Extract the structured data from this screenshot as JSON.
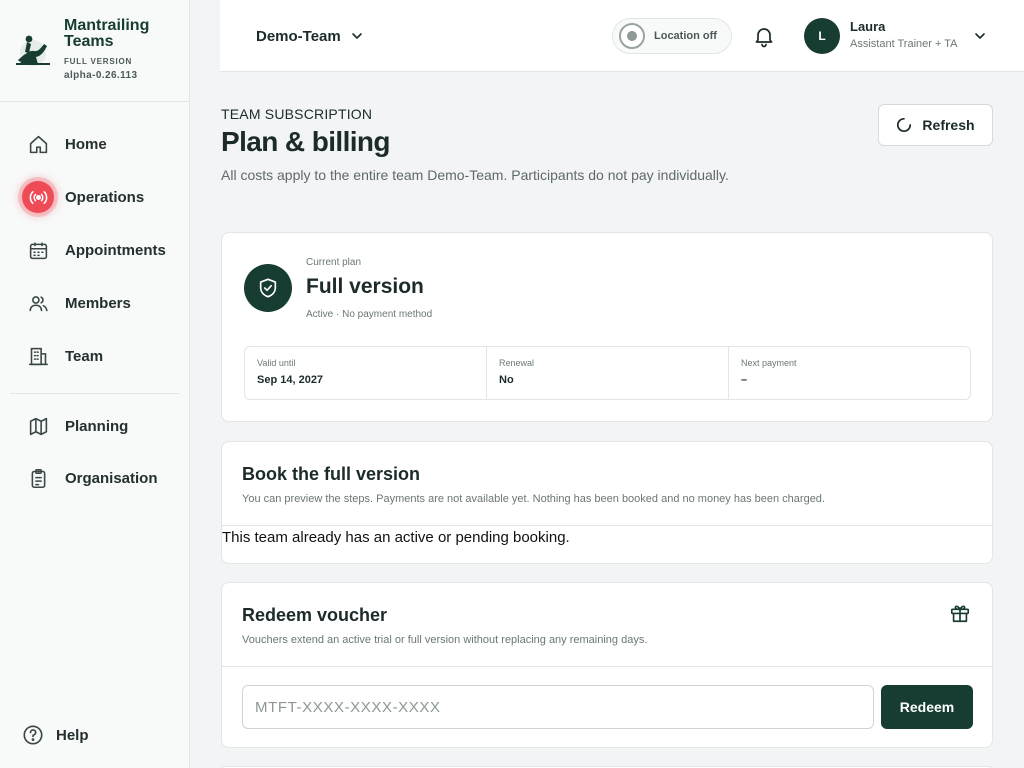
{
  "brand": {
    "name": "Mantrailing Teams",
    "edition": "FULL VERSION",
    "version": "alpha-0.26.113"
  },
  "sidebar": {
    "items": [
      {
        "label": "Home",
        "icon": "home-icon"
      },
      {
        "label": "Operations",
        "icon": "broadcast-icon",
        "live": true
      },
      {
        "label": "Appointments",
        "icon": "calendar-icon"
      },
      {
        "label": "Members",
        "icon": "users-icon"
      },
      {
        "label": "Team",
        "icon": "building-icon"
      },
      {
        "label": "Planning",
        "icon": "map-icon"
      },
      {
        "label": "Organisation",
        "icon": "clipboard-icon"
      }
    ],
    "help_label": "Help"
  },
  "header": {
    "team_name": "Demo-Team",
    "location_label": "Location off",
    "user": {
      "initial": "L",
      "name": "Laura",
      "role": "Assistant Trainer + TA"
    }
  },
  "page": {
    "eyebrow": "TEAM SUBSCRIPTION",
    "title": "Plan & billing",
    "subtitle": "All costs apply to the entire team Demo-Team. Participants do not pay individually.",
    "refresh_label": "Refresh"
  },
  "plan": {
    "meta_label": "Current plan",
    "name": "Full version",
    "status": "Active · No payment method",
    "stats": [
      {
        "label": "Valid until",
        "value": "Sep 14, 2027"
      },
      {
        "label": "Renewal",
        "value": "No"
      },
      {
        "label": "Next payment",
        "value": "–"
      }
    ]
  },
  "booking": {
    "title": "Book the full version",
    "subtitle": "You can preview the steps. Payments are not available yet. Nothing has been booked and no money has been charged.",
    "note": "This team already has an active or pending booking."
  },
  "voucher": {
    "title": "Redeem voucher",
    "subtitle": "Vouchers extend an active trial or full version without replacing any remaining days.",
    "placeholder": "MTFT-XXXX-XXXX-XXXX",
    "value": "",
    "button_label": "Redeem"
  },
  "colors": {
    "brand": "#173d33",
    "live": "#ef4b56",
    "background": "#f3f4f5"
  }
}
